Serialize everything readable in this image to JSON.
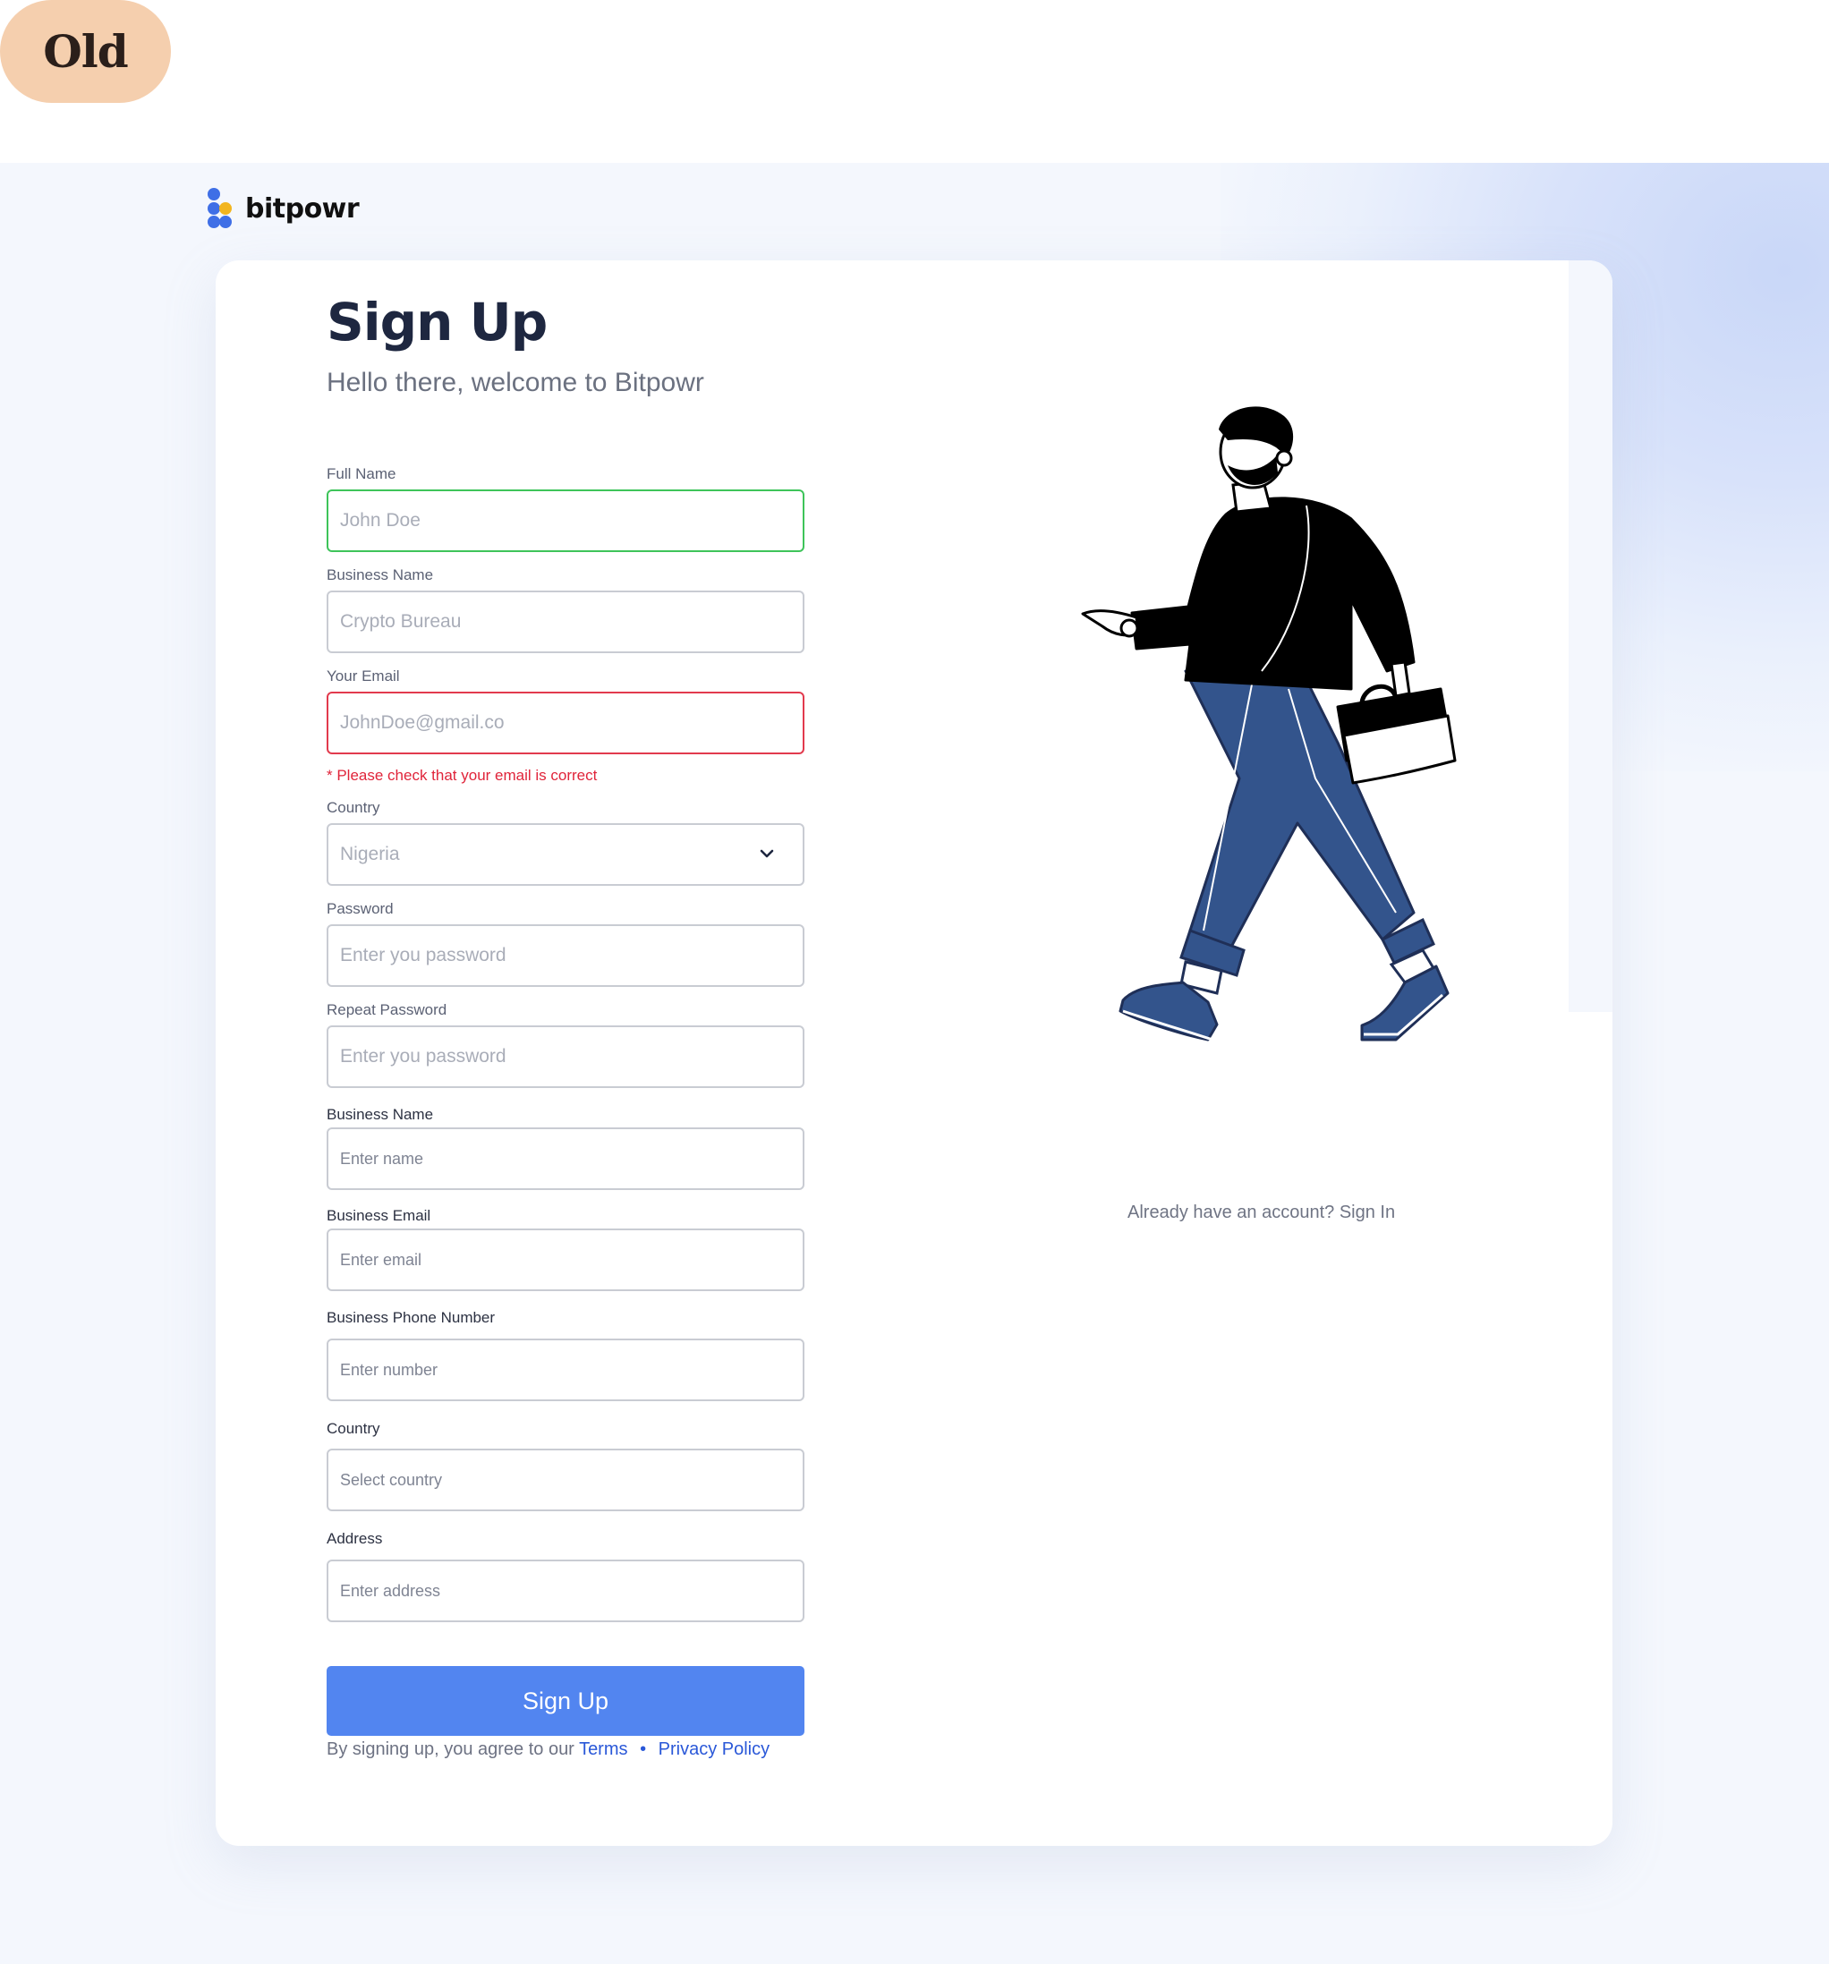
{
  "tag": {
    "label": "Old"
  },
  "brand": {
    "name": "bitpowr"
  },
  "page": {
    "title": "Sign Up",
    "subtitle": "Hello there, welcome to Bitpowr"
  },
  "form": {
    "full_name": {
      "label": "Full Name",
      "placeholder": "John Doe"
    },
    "business_name": {
      "label": "Business Name",
      "placeholder": "Crypto Bureau"
    },
    "email": {
      "label": "Your Email",
      "placeholder": "JohnDoe@gmail.co",
      "error": "* Please check that your email is correct"
    },
    "country": {
      "label": "Country",
      "value": "Nigeria"
    },
    "password": {
      "label": "Password",
      "placeholder": "Enter you password"
    },
    "repeat_password": {
      "label": "Repeat Password",
      "placeholder": "Enter you password"
    },
    "business_name_2": {
      "label": "Business Name",
      "placeholder": "Enter name"
    },
    "business_email": {
      "label": "Business Email",
      "placeholder": "Enter email"
    },
    "business_phone": {
      "label": "Business Phone Number",
      "placeholder": "Enter number"
    },
    "country_2": {
      "label": "Country",
      "placeholder": "Select country"
    },
    "address": {
      "label": "Address",
      "placeholder": "Enter address"
    },
    "submit_label": "Sign Up"
  },
  "footer": {
    "agree_text": "By signing up, you agree to our",
    "terms_link": "Terms",
    "separator": "•",
    "privacy_link": "Privacy Policy"
  },
  "signin_prompt": "Already have an account? Sign In",
  "colors": {
    "primary": "#5285f0",
    "success_border": "#3ec45a",
    "error": "#e0243a",
    "link": "#2a58d8",
    "illustration_pants": "#33548c"
  },
  "icons": {
    "logo": "bitpowr-logo-icon",
    "chevron": "chevron-down-icon",
    "illustration": "walking-man-with-briefcase"
  }
}
